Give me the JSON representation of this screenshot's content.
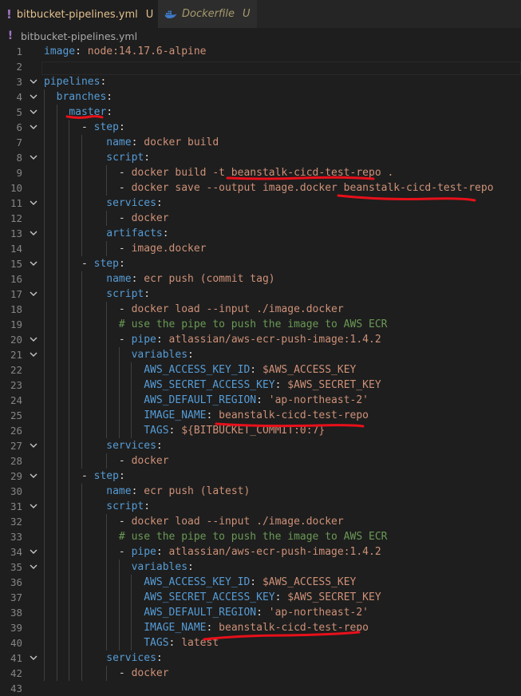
{
  "tabs": [
    {
      "label": "bitbucket-pipelines.yml",
      "status": "U",
      "close": "×",
      "icon": "yaml-exclamation-icon"
    },
    {
      "label": "Dockerfile",
      "status": "U",
      "icon": "docker-whale-icon"
    }
  ],
  "breadcrumb": {
    "icon": "yaml-exclamation-icon",
    "label": "bitbucket-pipelines.yml"
  },
  "icon_glyphs": {
    "yaml": "!",
    "fold": "chevron-down-icon"
  },
  "colors": {
    "key": "#569cd6",
    "string": "#ce9178",
    "comment": "#6a9955",
    "annotation": "#e8101a"
  },
  "lines": [
    {
      "n": "1",
      "fold": false,
      "segs": [
        {
          "t": "image",
          "c": "k"
        },
        {
          "t": ": ",
          "c": "p"
        },
        {
          "t": "node:14.17.6-alpine",
          "c": "s"
        }
      ]
    },
    {
      "n": "2",
      "fold": false,
      "segs": []
    },
    {
      "n": "3",
      "fold": true,
      "segs": [
        {
          "t": "pipelines",
          "c": "k"
        },
        {
          "t": ":",
          "c": "p"
        }
      ]
    },
    {
      "n": "4",
      "fold": true,
      "segs": [
        {
          "t": "  ",
          "c": "p"
        },
        {
          "t": "branches",
          "c": "k"
        },
        {
          "t": ":",
          "c": "p"
        }
      ]
    },
    {
      "n": "5",
      "fold": true,
      "segs": [
        {
          "t": "    ",
          "c": "p"
        },
        {
          "t": "master",
          "c": "k"
        },
        {
          "t": ":",
          "c": "p"
        }
      ]
    },
    {
      "n": "6",
      "fold": true,
      "segs": [
        {
          "t": "      - ",
          "c": "p"
        },
        {
          "t": "step",
          "c": "k"
        },
        {
          "t": ":",
          "c": "p"
        }
      ]
    },
    {
      "n": "7",
      "fold": false,
      "segs": [
        {
          "t": "          ",
          "c": "p"
        },
        {
          "t": "name",
          "c": "k"
        },
        {
          "t": ": ",
          "c": "p"
        },
        {
          "t": "docker build",
          "c": "s"
        }
      ]
    },
    {
      "n": "8",
      "fold": true,
      "segs": [
        {
          "t": "          ",
          "c": "p"
        },
        {
          "t": "script",
          "c": "k"
        },
        {
          "t": ":",
          "c": "p"
        }
      ]
    },
    {
      "n": "9",
      "fold": false,
      "segs": [
        {
          "t": "            - ",
          "c": "p"
        },
        {
          "t": "docker build -t beanstalk-cicd-test-repo .",
          "c": "s"
        }
      ]
    },
    {
      "n": "10",
      "fold": false,
      "segs": [
        {
          "t": "            - ",
          "c": "p"
        },
        {
          "t": "docker save --output image.docker beanstalk-cicd-test-repo",
          "c": "s"
        }
      ]
    },
    {
      "n": "11",
      "fold": true,
      "segs": [
        {
          "t": "          ",
          "c": "p"
        },
        {
          "t": "services",
          "c": "k"
        },
        {
          "t": ":",
          "c": "p"
        }
      ]
    },
    {
      "n": "12",
      "fold": false,
      "segs": [
        {
          "t": "            - ",
          "c": "p"
        },
        {
          "t": "docker",
          "c": "s"
        }
      ]
    },
    {
      "n": "13",
      "fold": true,
      "segs": [
        {
          "t": "          ",
          "c": "p"
        },
        {
          "t": "artifacts",
          "c": "k"
        },
        {
          "t": ":",
          "c": "p"
        }
      ]
    },
    {
      "n": "14",
      "fold": false,
      "segs": [
        {
          "t": "            - ",
          "c": "p"
        },
        {
          "t": "image.docker",
          "c": "s"
        }
      ]
    },
    {
      "n": "15",
      "fold": true,
      "segs": [
        {
          "t": "      - ",
          "c": "p"
        },
        {
          "t": "step",
          "c": "k"
        },
        {
          "t": ":",
          "c": "p"
        }
      ]
    },
    {
      "n": "16",
      "fold": false,
      "segs": [
        {
          "t": "          ",
          "c": "p"
        },
        {
          "t": "name",
          "c": "k"
        },
        {
          "t": ": ",
          "c": "p"
        },
        {
          "t": "ecr push (commit tag)",
          "c": "s"
        }
      ]
    },
    {
      "n": "17",
      "fold": true,
      "segs": [
        {
          "t": "          ",
          "c": "p"
        },
        {
          "t": "script",
          "c": "k"
        },
        {
          "t": ":",
          "c": "p"
        }
      ]
    },
    {
      "n": "18",
      "fold": false,
      "segs": [
        {
          "t": "            - ",
          "c": "p"
        },
        {
          "t": "docker load --input ./image.docker",
          "c": "s"
        }
      ]
    },
    {
      "n": "19",
      "fold": false,
      "segs": [
        {
          "t": "            ",
          "c": "p"
        },
        {
          "t": "# use the pipe to push the image to AWS ECR",
          "c": "c"
        }
      ]
    },
    {
      "n": "20",
      "fold": true,
      "segs": [
        {
          "t": "            - ",
          "c": "p"
        },
        {
          "t": "pipe",
          "c": "k"
        },
        {
          "t": ": ",
          "c": "p"
        },
        {
          "t": "atlassian/aws-ecr-push-image:1.4.2",
          "c": "s"
        }
      ]
    },
    {
      "n": "21",
      "fold": true,
      "segs": [
        {
          "t": "              ",
          "c": "p"
        },
        {
          "t": "variables",
          "c": "k"
        },
        {
          "t": ":",
          "c": "p"
        }
      ]
    },
    {
      "n": "22",
      "fold": false,
      "segs": [
        {
          "t": "                ",
          "c": "p"
        },
        {
          "t": "AWS_ACCESS_KEY_ID",
          "c": "k"
        },
        {
          "t": ": ",
          "c": "p"
        },
        {
          "t": "$AWS_ACCESS_KEY",
          "c": "s"
        }
      ]
    },
    {
      "n": "23",
      "fold": false,
      "segs": [
        {
          "t": "                ",
          "c": "p"
        },
        {
          "t": "AWS_SECRET_ACCESS_KEY",
          "c": "k"
        },
        {
          "t": ": ",
          "c": "p"
        },
        {
          "t": "$AWS_SECRET_KEY",
          "c": "s"
        }
      ]
    },
    {
      "n": "24",
      "fold": false,
      "segs": [
        {
          "t": "                ",
          "c": "p"
        },
        {
          "t": "AWS_DEFAULT_REGION",
          "c": "k"
        },
        {
          "t": ": ",
          "c": "p"
        },
        {
          "t": "'ap-northeast-2'",
          "c": "s"
        }
      ]
    },
    {
      "n": "25",
      "fold": false,
      "segs": [
        {
          "t": "                ",
          "c": "p"
        },
        {
          "t": "IMAGE_NAME",
          "c": "k"
        },
        {
          "t": ": ",
          "c": "p"
        },
        {
          "t": "beanstalk-cicd-test-repo",
          "c": "s"
        }
      ]
    },
    {
      "n": "26",
      "fold": false,
      "segs": [
        {
          "t": "                ",
          "c": "p"
        },
        {
          "t": "TAGS",
          "c": "k"
        },
        {
          "t": ": ",
          "c": "p"
        },
        {
          "t": "${BITBUCKET_COMMIT:0:7}",
          "c": "s"
        }
      ]
    },
    {
      "n": "27",
      "fold": true,
      "segs": [
        {
          "t": "          ",
          "c": "p"
        },
        {
          "t": "services",
          "c": "k"
        },
        {
          "t": ":",
          "c": "p"
        }
      ]
    },
    {
      "n": "28",
      "fold": false,
      "segs": [
        {
          "t": "            - ",
          "c": "p"
        },
        {
          "t": "docker",
          "c": "s"
        }
      ]
    },
    {
      "n": "29",
      "fold": true,
      "segs": [
        {
          "t": "      - ",
          "c": "p"
        },
        {
          "t": "step",
          "c": "k"
        },
        {
          "t": ":",
          "c": "p"
        }
      ]
    },
    {
      "n": "30",
      "fold": false,
      "segs": [
        {
          "t": "          ",
          "c": "p"
        },
        {
          "t": "name",
          "c": "k"
        },
        {
          "t": ": ",
          "c": "p"
        },
        {
          "t": "ecr push (latest)",
          "c": "s"
        }
      ]
    },
    {
      "n": "31",
      "fold": true,
      "segs": [
        {
          "t": "          ",
          "c": "p"
        },
        {
          "t": "script",
          "c": "k"
        },
        {
          "t": ":",
          "c": "p"
        }
      ]
    },
    {
      "n": "32",
      "fold": false,
      "segs": [
        {
          "t": "            - ",
          "c": "p"
        },
        {
          "t": "docker load --input ./image.docker",
          "c": "s"
        }
      ]
    },
    {
      "n": "33",
      "fold": false,
      "segs": [
        {
          "t": "            ",
          "c": "p"
        },
        {
          "t": "# use the pipe to push the image to AWS ECR",
          "c": "c"
        }
      ]
    },
    {
      "n": "34",
      "fold": true,
      "segs": [
        {
          "t": "            - ",
          "c": "p"
        },
        {
          "t": "pipe",
          "c": "k"
        },
        {
          "t": ": ",
          "c": "p"
        },
        {
          "t": "atlassian/aws-ecr-push-image:1.4.2",
          "c": "s"
        }
      ]
    },
    {
      "n": "35",
      "fold": true,
      "segs": [
        {
          "t": "              ",
          "c": "p"
        },
        {
          "t": "variables",
          "c": "k"
        },
        {
          "t": ":",
          "c": "p"
        }
      ]
    },
    {
      "n": "36",
      "fold": false,
      "segs": [
        {
          "t": "                ",
          "c": "p"
        },
        {
          "t": "AWS_ACCESS_KEY_ID",
          "c": "k"
        },
        {
          "t": ": ",
          "c": "p"
        },
        {
          "t": "$AWS_ACCESS_KEY",
          "c": "s"
        }
      ]
    },
    {
      "n": "37",
      "fold": false,
      "segs": [
        {
          "t": "                ",
          "c": "p"
        },
        {
          "t": "AWS_SECRET_ACCESS_KEY",
          "c": "k"
        },
        {
          "t": ": ",
          "c": "p"
        },
        {
          "t": "$AWS_SECRET_KEY",
          "c": "s"
        }
      ]
    },
    {
      "n": "38",
      "fold": false,
      "segs": [
        {
          "t": "                ",
          "c": "p"
        },
        {
          "t": "AWS_DEFAULT_REGION",
          "c": "k"
        },
        {
          "t": ": ",
          "c": "p"
        },
        {
          "t": "'ap-northeast-2'",
          "c": "s"
        }
      ]
    },
    {
      "n": "39",
      "fold": false,
      "segs": [
        {
          "t": "                ",
          "c": "p"
        },
        {
          "t": "IMAGE_NAME",
          "c": "k"
        },
        {
          "t": ": ",
          "c": "p"
        },
        {
          "t": "beanstalk-cicd-test-repo",
          "c": "s"
        }
      ]
    },
    {
      "n": "40",
      "fold": false,
      "segs": [
        {
          "t": "                ",
          "c": "p"
        },
        {
          "t": "TAGS",
          "c": "k"
        },
        {
          "t": ": ",
          "c": "p"
        },
        {
          "t": "latest",
          "c": "s"
        }
      ]
    },
    {
      "n": "41",
      "fold": true,
      "segs": [
        {
          "t": "          ",
          "c": "p"
        },
        {
          "t": "services",
          "c": "k"
        },
        {
          "t": ":",
          "c": "p"
        }
      ]
    },
    {
      "n": "42",
      "fold": false,
      "segs": [
        {
          "t": "            - ",
          "c": "p"
        },
        {
          "t": "docker",
          "c": "s"
        }
      ]
    },
    {
      "n": "43",
      "fold": false,
      "segs": []
    }
  ]
}
